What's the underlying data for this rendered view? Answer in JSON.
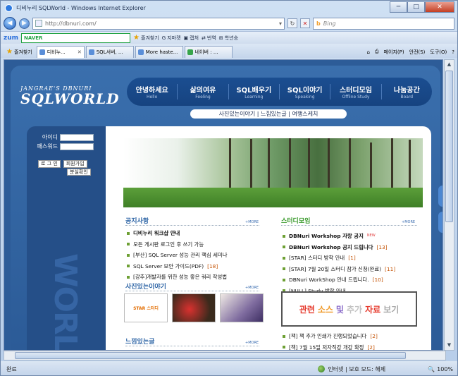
{
  "window": {
    "title": "디비누리 SQLWorld - Windows Internet Explorer",
    "min": "─",
    "max": "□",
    "close": "✕"
  },
  "address": {
    "url": "http://dbnuri.com/",
    "search_placeholder": "Bing"
  },
  "toolbar": {
    "zum": "zum",
    "naver": "NAVER",
    "items": [
      "즐겨찾기",
      "지마켓",
      "캡처",
      "번역",
      "학년승"
    ]
  },
  "favorites": {
    "label": "즐겨찾기"
  },
  "tabs": [
    "디비누...",
    "SQL서버, ...",
    "More haste...",
    "네이버 : ..."
  ],
  "commands": [
    "페이지(P)",
    "안전(S)",
    "도구(O)"
  ],
  "site": {
    "logo_top": "JANGRAE'S DBNURI",
    "logo_main": "SQLWORLD",
    "nav": [
      {
        "ko": "안녕하세요",
        "en": "Hello"
      },
      {
        "ko": "삶의여유",
        "en": "Feeling"
      },
      {
        "ko": "SQL배우기",
        "en": "Learning"
      },
      {
        "ko": "SQL이야기",
        "en": "Speaking"
      },
      {
        "ko": "스터디모임",
        "en": "Offline Study"
      },
      {
        "ko": "나눔공간",
        "en": "Board"
      }
    ],
    "subnav": "사진있는이야기 | 느낌있는글 | 여행스케치",
    "login": {
      "id_label": "아이디",
      "pw_label": "패스워드",
      "login_btn": "로 그 인",
      "join_btn": "회원가입",
      "lost_btn": "분실확인"
    },
    "watermark": "WORLD",
    "notice": {
      "title": "공지사항",
      "more": "+MORE",
      "items": [
        {
          "text": "디비누리 워크샵 안내",
          "bold": true,
          "count": ""
        },
        {
          "text": "모든 게시판 로그인 후 쓰기 가능",
          "bold": false,
          "count": ""
        },
        {
          "text": "[부산] SQL Server 성능 관리 핵심 세미나",
          "bold": false,
          "count": ""
        },
        {
          "text": "SQL Server 보안 가이드(PDF)",
          "bold": false,
          "count": "[18]"
        },
        {
          "text": "[강추]개발자를 위한 성능 좋은 쿼리 작성법",
          "bold": false,
          "count": ""
        }
      ]
    },
    "photo": {
      "title": "사진있는이야기",
      "more": "+MORE",
      "thumb1": "STAR 스터디"
    },
    "feel": {
      "title": "느낌있는글",
      "more": "+MORE"
    },
    "study": {
      "title": "스터디모임",
      "more": "+MORE",
      "items": [
        {
          "text": "DBNuri Workshop 자랑 공지",
          "bold": true,
          "count": "",
          "new": "NEW"
        },
        {
          "text": "DBNuri Workshop 공지 드립니다",
          "bold": true,
          "count": "[13]",
          "new": ""
        },
        {
          "text": "[STAR] 스터디 방학 안내",
          "bold": false,
          "count": "[1]",
          "new": ""
        },
        {
          "text": "[STAR] 7월 20일 스터디 참가 신청(완료)",
          "bold": false,
          "count": "[11]",
          "new": ""
        },
        {
          "text": "DBNuri WorkShop 안내 드립니다.",
          "bold": false,
          "count": "[10]",
          "new": ""
        },
        {
          "text": "[NULL] Study 방학 안내",
          "bold": false,
          "count": "",
          "new": ""
        }
      ]
    },
    "related": [
      "관련",
      "소스",
      "및",
      "추가",
      "자료",
      "보기"
    ],
    "books": [
      {
        "text": "[책] 책 추가 인쇄가 진행되었습니다",
        "count": "[2]"
      },
      {
        "text": "[책] 7월 15일 저자직강 개강 확정",
        "count": "[2]"
      }
    ]
  },
  "status": {
    "left": "완료",
    "zone": "인터넷 | 보호 모드: 해제",
    "zoom": "100%"
  }
}
